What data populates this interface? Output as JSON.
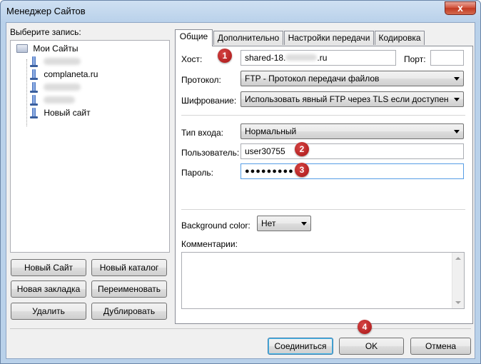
{
  "window": {
    "title": "Менеджер Сайтов",
    "close_glyph": "x"
  },
  "left": {
    "select_label": "Выберите запись:",
    "tree": {
      "root": "Мои Сайты",
      "items": [
        {
          "label": "",
          "redacted": true
        },
        {
          "label": "complaneta.ru",
          "redacted": false
        },
        {
          "label": "",
          "redacted": true
        },
        {
          "label": "",
          "redacted": true
        },
        {
          "label": "Новый сайт",
          "redacted": false
        }
      ]
    },
    "buttons": {
      "new_site": "Новый Сайт",
      "new_folder": "Новый каталог",
      "new_bookmark": "Новая закладка",
      "rename": "Переименовать",
      "delete": "Удалить",
      "duplicate": "Дублировать"
    }
  },
  "tabs": [
    "Общие",
    "Дополнительно",
    "Настройки передачи",
    "Кодировка"
  ],
  "general": {
    "host_label": "Хост:",
    "host_value_prefix": "shared-18.",
    "host_value_suffix": ".ru",
    "port_label": "Порт:",
    "port_value": "",
    "protocol_label": "Протокол:",
    "protocol_value": "FTP - Протокол передачи файлов",
    "encryption_label": "Шифрование:",
    "encryption_value": "Использовать явный FTP через TLS если доступен",
    "logon_label": "Тип входа:",
    "logon_value": "Нормальный",
    "user_label": "Пользователь:",
    "user_value": "user30755",
    "password_label": "Пароль:",
    "password_value": "●●●●●●●●●",
    "bgcolor_label": "Background color:",
    "bgcolor_value": "Нет",
    "comments_label": "Комментарии:"
  },
  "badges": [
    "1",
    "2",
    "3",
    "4"
  ],
  "footer": {
    "connect": "Соединиться",
    "ok": "OK",
    "cancel": "Отмена"
  },
  "colors": {
    "badge": "#b81c1c",
    "title_bar": "#b9d1ea",
    "focus": "#569de5"
  }
}
